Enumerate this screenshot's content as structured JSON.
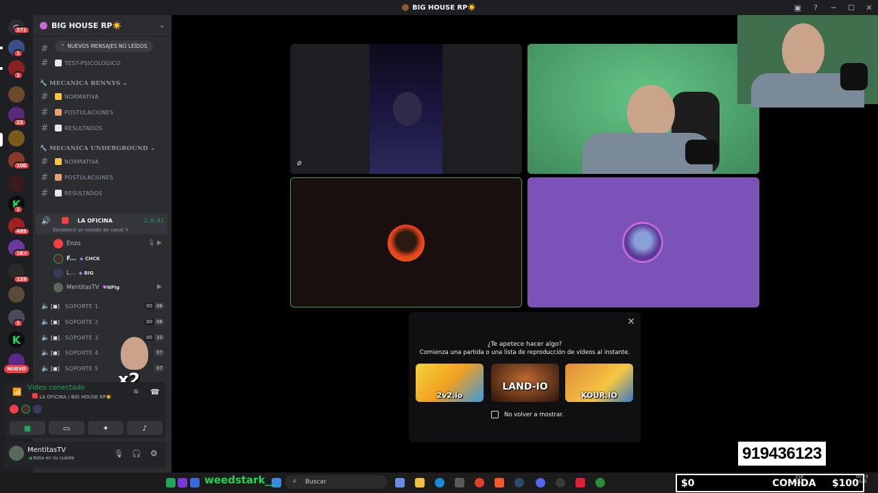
{
  "window": {
    "title": "BIG HOUSE RP☀️"
  },
  "rail": {
    "badges": [
      "371",
      "1",
      "1",
      "22",
      "1",
      "100",
      "1",
      "489",
      "1K+",
      "129",
      "1"
    ],
    "new_label": "NUEVO"
  },
  "guild": {
    "name": "BIG HOUSE RP☀️",
    "unread_pill": "NUEVOS MENSAJES NO LEÍDOS"
  },
  "channels": {
    "top": "TEST-PSICOLOGICO",
    "cat1": "MECANICA BENNYS",
    "cat1_items": [
      "NORMATIVA",
      "POSTULACIONES",
      "RESULTADOS"
    ],
    "cat2": "MECANICA UNDERGROUND",
    "cat2_items": [
      "NORMATIVA",
      "POSTULACIONES",
      "RESULTADOS"
    ]
  },
  "voice": {
    "active_channel": "LA OFICINA",
    "active_time": "2:8:41",
    "status_hint": "Establece un estado de canal",
    "members": [
      {
        "name": "Enzo",
        "tag": ""
      },
      {
        "name": "F...",
        "tag": "CHCK"
      },
      {
        "name": "L...",
        "tag": "BIG"
      },
      {
        "name": "MentitasTV",
        "tag": "NPig"
      }
    ],
    "support": [
      {
        "name": "SOPORTE 1",
        "a": "00",
        "b": "08"
      },
      {
        "name": "SOPORTE 2",
        "a": "00",
        "b": "06"
      },
      {
        "name": "SOPORTE 3",
        "a": "00",
        "b": "10"
      },
      {
        "name": "SOPORTE 4",
        "a": "",
        "b": "07"
      },
      {
        "name": "SOPORTE 5",
        "a": "",
        "b": "07"
      }
    ],
    "overlay_multiplier": "x2"
  },
  "voice_panel": {
    "title": "Vídeo conectado",
    "subtitle": "LA OFICINA / BIG HOUSE RP☀️"
  },
  "user": {
    "name": "MentitasTV",
    "status": "Keta en tu culote"
  },
  "popup": {
    "question": "¿Te apetece hacer algo?",
    "subtitle": "Comienza una partida o una lista de reproducción de vídeos al instante.",
    "games": [
      "2v2.io",
      "LAND-IO",
      "KOUR.IO"
    ],
    "dont_show": "No volver a mostrar."
  },
  "taskbar": {
    "streamer": "weedstark__",
    "search_placeholder": "Buscar",
    "lang1": "ESP",
    "lang2": "LAA",
    "time": "00:23",
    "date": "2025"
  },
  "stream_overlay": {
    "counter": "919436123",
    "money": "$0",
    "label": "COMIDA",
    "price": "$100"
  },
  "colors": {
    "accent_green": "#23a55a",
    "danger": "#f23f43",
    "tile_purple": "#7a52b8",
    "tile_green": "#3f8a5a"
  }
}
